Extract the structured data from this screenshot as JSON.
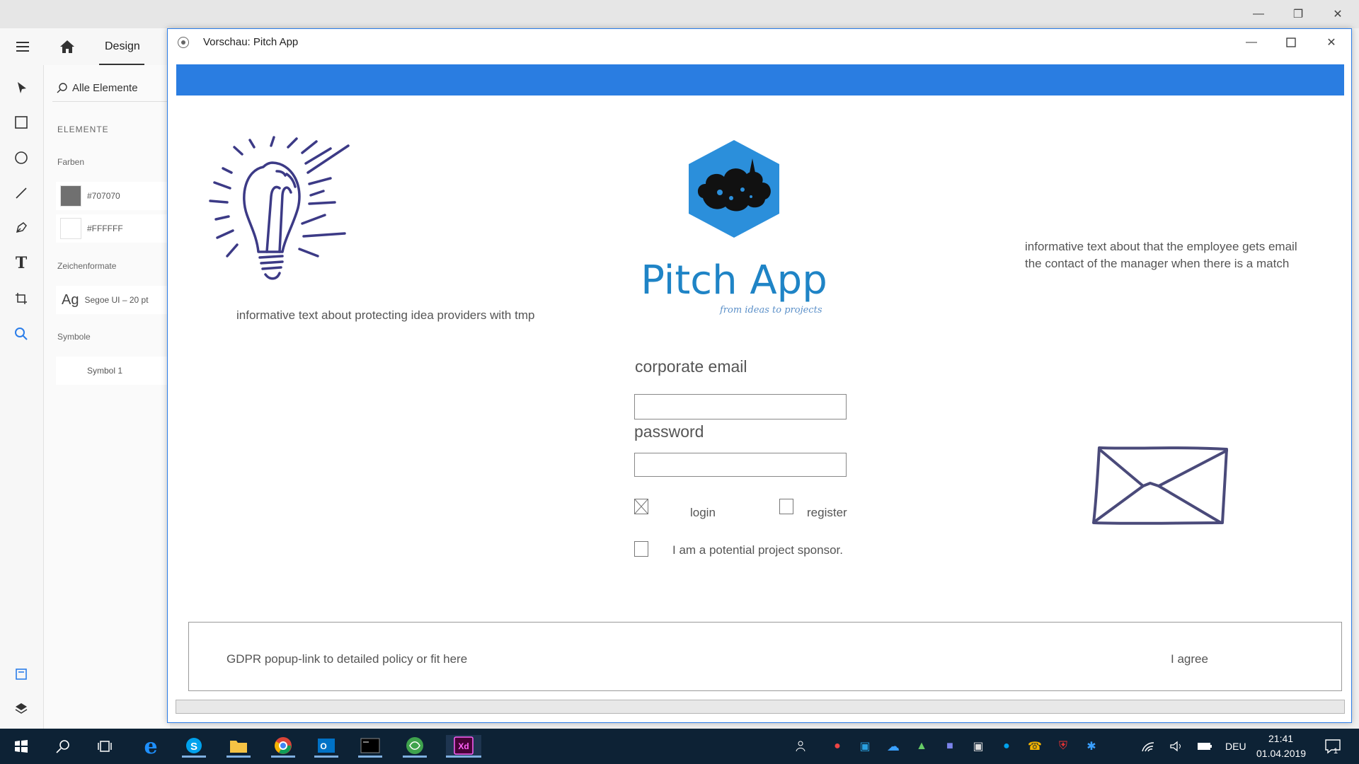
{
  "xd": {
    "tab_design": "Design",
    "search_placeholder": "Alle Elemente",
    "section_elements": "ELEMENTE",
    "colors_label": "Farben",
    "colors": [
      {
        "hex": "#707070",
        "label": "#707070"
      },
      {
        "hex": "#FFFFFF",
        "label": "#FFFFFF"
      }
    ],
    "char_styles_label": "Zeichenformate",
    "char_style_sample": "Ag",
    "char_style_name": "Segoe UI – 20 pt",
    "symbols_label": "Symbole",
    "symbol_name": "Symbol 1"
  },
  "preview": {
    "title": "Vorschau: Pitch App",
    "accent": "#2a7de1"
  },
  "app": {
    "info_left": "informative text about protecting idea providers with tmp",
    "info_right_1": "informative text about that the employee gets email",
    "info_right_2": "the contact of the manager when there is a match",
    "logo_title": "Pitch App",
    "logo_tagline": "from ideas to projects",
    "email_label": "corporate email",
    "email_value": "",
    "password_label": "password",
    "password_value": "",
    "login_label": "login",
    "login_checked": true,
    "register_label": "register",
    "register_checked": false,
    "sponsor_label": "I am a potential project sponsor.",
    "sponsor_checked": false,
    "gdpr_text": "GDPR popup-link to detailed policy or fit here",
    "gdpr_agree": "I agree"
  },
  "taskbar": {
    "language": "DEU",
    "time": "21:41",
    "date": "01.04.2019",
    "notification_count": "1",
    "apps": [
      "windows-start",
      "search",
      "task-view",
      "edge",
      "skype",
      "file-explorer",
      "chrome",
      "outlook",
      "terminal",
      "app-green",
      "adobe-xd"
    ]
  }
}
